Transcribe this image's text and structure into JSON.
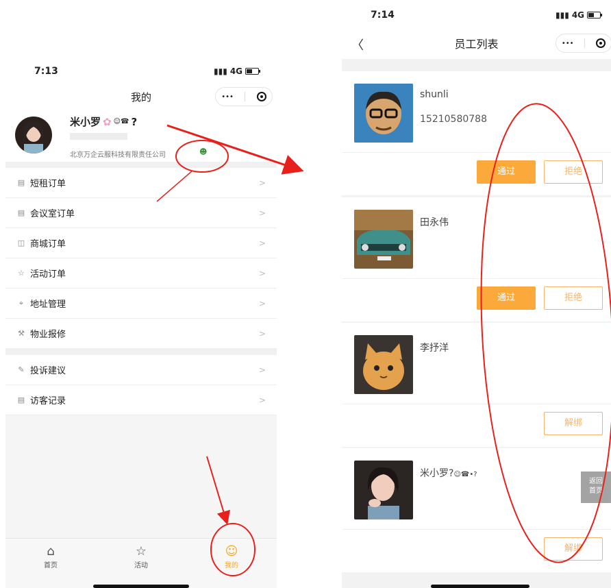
{
  "left": {
    "status": {
      "time": "7:13",
      "network": "4G"
    },
    "nav": {
      "title": "我的",
      "more": "•••"
    },
    "profile": {
      "name": "米小罗",
      "name_suffix": "?",
      "company": "北京万企云服科技有限责任公司"
    },
    "menu": [
      {
        "icon": "▤",
        "label": "短租订单"
      },
      {
        "icon": "▤",
        "label": "会议室订单"
      },
      {
        "icon": "◫",
        "label": "商城订单"
      },
      {
        "icon": "☆",
        "label": "活动订单"
      },
      {
        "icon": "⌖",
        "label": "地址管理"
      },
      {
        "icon": "⚒",
        "label": "物业报修"
      }
    ],
    "menu2": [
      {
        "icon": "✎",
        "label": "投诉建议"
      },
      {
        "icon": "▤",
        "label": "访客记录"
      }
    ],
    "chevron": ">",
    "tabs": [
      {
        "icon": "⌂",
        "label": "首页"
      },
      {
        "icon": "☆",
        "label": "活动"
      },
      {
        "icon": "☺",
        "label": "我的"
      }
    ]
  },
  "right": {
    "status": {
      "time": "7:14",
      "network": "4G"
    },
    "nav": {
      "back": "〈",
      "title": "员工列表",
      "more": "•••"
    },
    "employees": [
      {
        "name": "shunli",
        "phone": "15210580788",
        "actions": [
          "通过",
          "拒绝"
        ]
      },
      {
        "name": "田永伟",
        "phone": "",
        "actions": [
          "通过",
          "拒绝"
        ]
      },
      {
        "name": "李抒洋",
        "phone": "",
        "actions": [
          "解绑"
        ]
      },
      {
        "name": "米小罗?",
        "phone": "",
        "actions": [
          "解绑"
        ]
      }
    ],
    "float_home": [
      "返回",
      "首页"
    ]
  },
  "colors": {
    "accent": "#fba93a",
    "annotation": "#e8201c"
  }
}
